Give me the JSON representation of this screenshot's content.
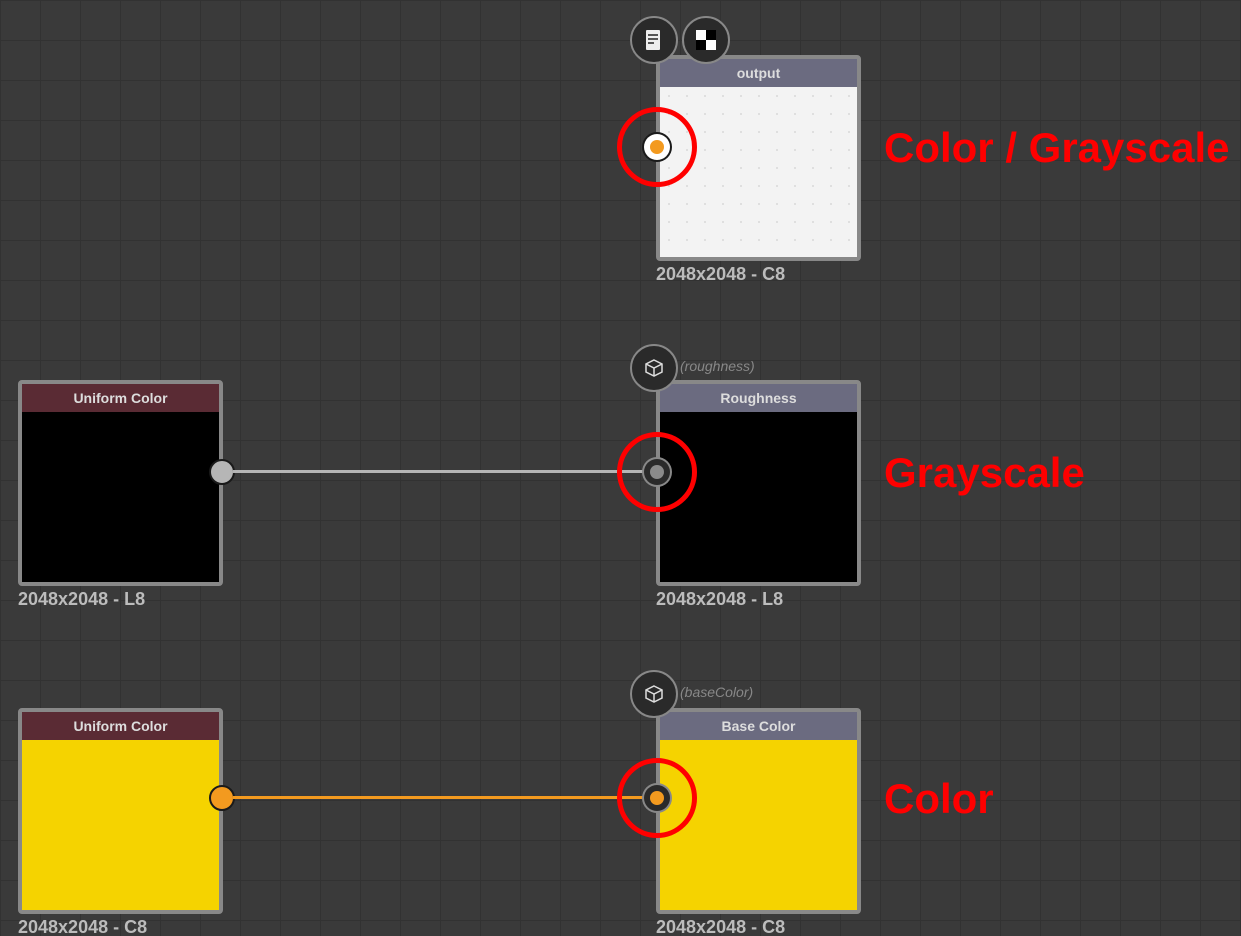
{
  "nodes": {
    "output": {
      "title": "output",
      "caption": "2048x2048 - C8",
      "annotation": "Color / Grayscale"
    },
    "roughness": {
      "title": "Roughness",
      "subcaption": "(roughness)",
      "caption": "2048x2048 - L8",
      "annotation": "Grayscale"
    },
    "basecolor": {
      "title": "Base Color",
      "subcaption": "(baseColor)",
      "caption": "2048x2048 - C8",
      "annotation": "Color"
    },
    "uniform_gray": {
      "title": "Uniform Color",
      "caption": "2048x2048 - L8"
    },
    "uniform_yellow": {
      "title": "Uniform Color",
      "caption": "2048x2048 - C8"
    }
  },
  "colors": {
    "accent_orange": "#f39a1f",
    "port_gray": "#b6b6b6",
    "highlight": "#ff0000",
    "title_maroon": "#5a2b34",
    "title_gray": "#6b6b80",
    "yellow_fill": "#f5d300"
  }
}
